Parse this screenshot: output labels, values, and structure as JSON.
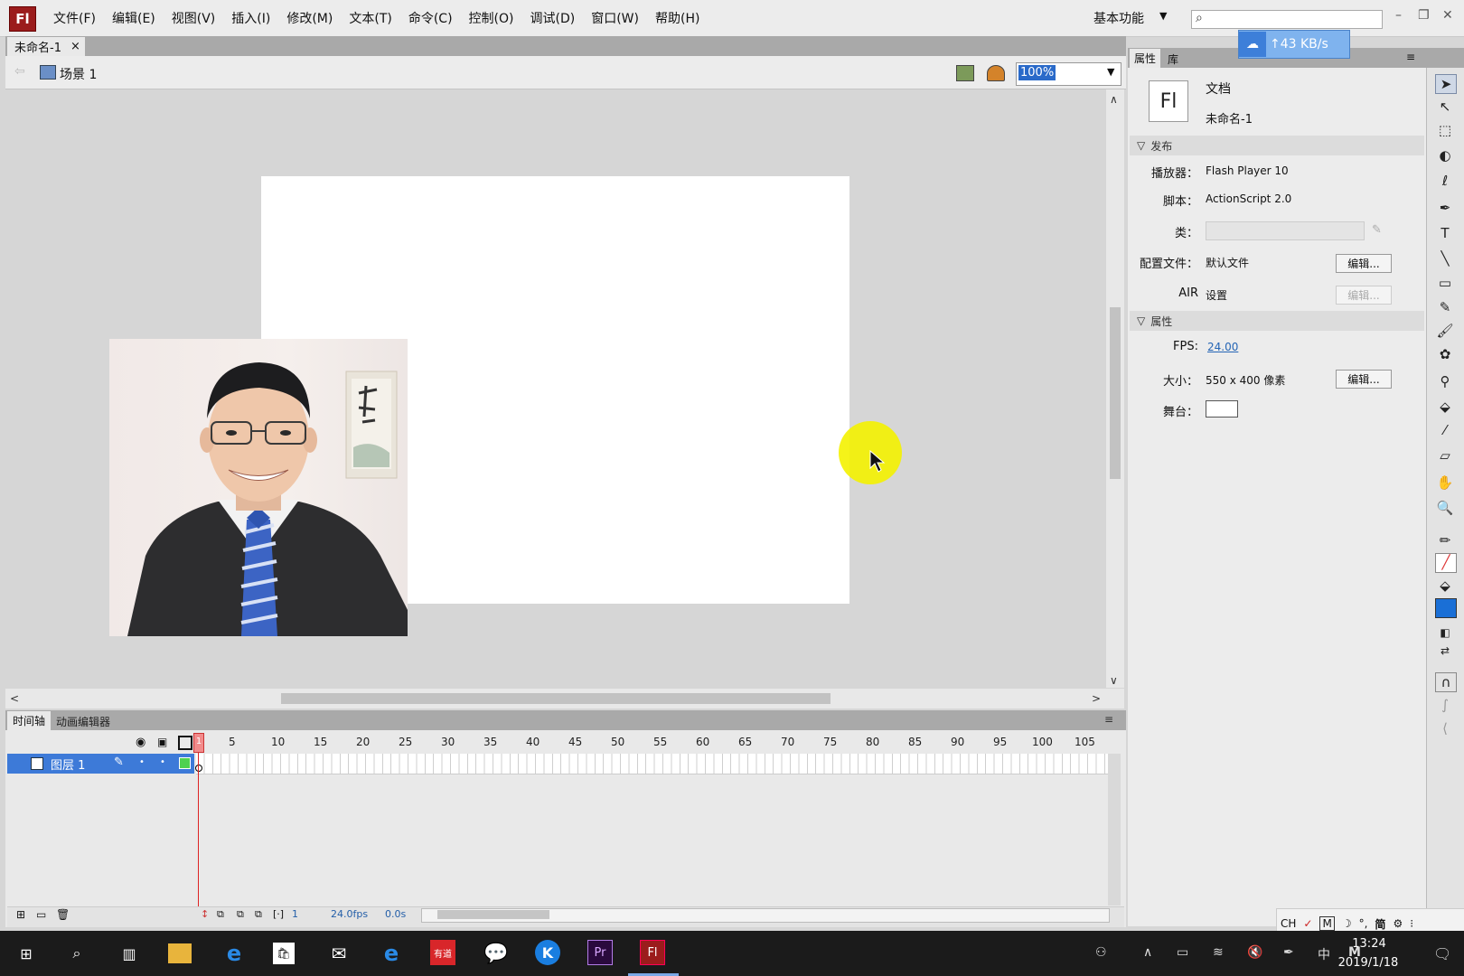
{
  "app": {
    "logo": "Fl",
    "workspace": "基本功能",
    "search_placeholder": ""
  },
  "menu": [
    "文件(F)",
    "编辑(E)",
    "视图(V)",
    "插入(I)",
    "修改(M)",
    "文本(T)",
    "命令(C)",
    "控制(O)",
    "调试(D)",
    "窗口(W)",
    "帮助(H)"
  ],
  "document": {
    "tab_title": "未命名-1",
    "tab_close": "×"
  },
  "editbar": {
    "scene": "场景 1",
    "zoom": "100%"
  },
  "upload": {
    "speed": "↑43 KB/s"
  },
  "timeline": {
    "tabs": [
      "时间轴",
      "动画编辑器"
    ],
    "ruler": [
      "1",
      "5",
      "10",
      "15",
      "20",
      "25",
      "30",
      "35",
      "40",
      "45",
      "50",
      "55",
      "60",
      "65",
      "70",
      "75",
      "80",
      "85",
      "90",
      "95",
      "100",
      "105"
    ],
    "layer_name": "图层 1",
    "frame": "1",
    "fps": "24.0fps",
    "time": "0.0s"
  },
  "panel": {
    "tabs": [
      "属性",
      "库"
    ],
    "doc_icon": "Fl",
    "doc_type": "文档",
    "doc_name": "未命名-1",
    "publish_section": "发布",
    "player_label": "播放器：",
    "player_value": "Flash Player 10",
    "script_label": "脚本：",
    "script_value": "ActionScript 2.0",
    "class_label": "类：",
    "profile_label": "配置文件：",
    "profile_value": "默认文件",
    "edit_btn": "编辑...",
    "air_label": "AIR",
    "air_value": "设置",
    "props_section": "属性",
    "fps_label": "FPS:",
    "fps_value": "24.00",
    "size_label": "大小：",
    "size_value": "550 x 400 像素",
    "stage_label": "舞台："
  },
  "ime": [
    "CH",
    "M",
    "简"
  ],
  "taskbar": {
    "time": "13:24",
    "date": "2019/1/18",
    "ime_lang": "中",
    "ime_mode": "M"
  },
  "colors": {
    "accent": "#3d7ad8",
    "stage": "#ffffff",
    "highlight": "#f4f200",
    "fill": "#1a6fd6"
  }
}
